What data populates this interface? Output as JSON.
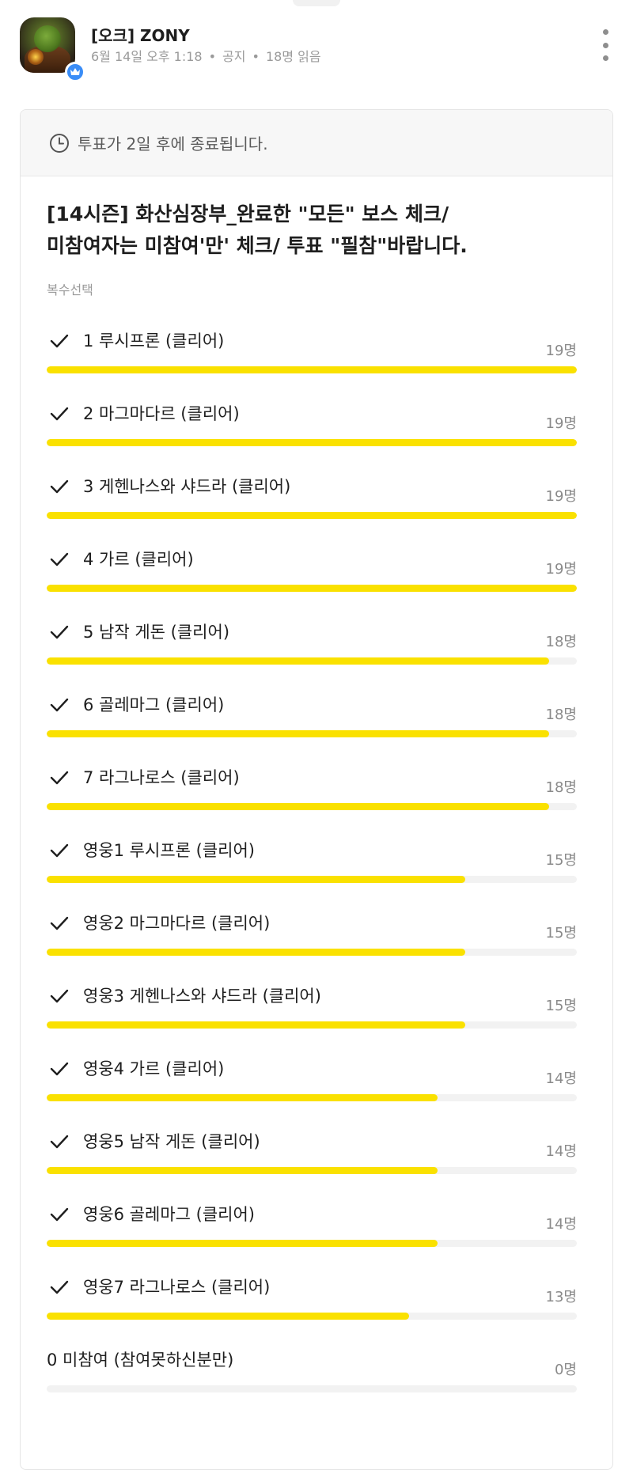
{
  "post": {
    "author": "[오크] ZONY",
    "date": "6월 14일 오후 1:18",
    "category": "공지",
    "reads": "18명 읽음",
    "badge_icon": "crown-icon",
    "more_icon": "more-vertical-icon"
  },
  "poll": {
    "notice": "투표가 2일 후에 종료됩니다.",
    "title_line1": "[14시즌] 화산심장부_완료한 \"모든\" 보스 체크/",
    "title_line2": "미참여자는 미참여'만' 체크/ 투표 \"필참\"바랍니다.",
    "mode": "복수선택",
    "total_voters": 19,
    "accent_color": "#fae100",
    "options": [
      {
        "label": "1 루시프론 (클리어)",
        "count": "19명",
        "votes": 19,
        "checked": true
      },
      {
        "label": "2 마그마다르 (클리어)",
        "count": "19명",
        "votes": 19,
        "checked": true
      },
      {
        "label": "3 게헨나스와 샤드라 (클리어)",
        "count": "19명",
        "votes": 19,
        "checked": true
      },
      {
        "label": "4 가르 (클리어)",
        "count": "19명",
        "votes": 19,
        "checked": true
      },
      {
        "label": "5 남작 게돈 (클리어)",
        "count": "18명",
        "votes": 18,
        "checked": true
      },
      {
        "label": "6 골레마그 (클리어)",
        "count": "18명",
        "votes": 18,
        "checked": true
      },
      {
        "label": "7 라그나로스 (클리어)",
        "count": "18명",
        "votes": 18,
        "checked": true
      },
      {
        "label": "영웅1 루시프론 (클리어)",
        "count": "15명",
        "votes": 15,
        "checked": true
      },
      {
        "label": "영웅2 마그마다르 (클리어)",
        "count": "15명",
        "votes": 15,
        "checked": true
      },
      {
        "label": "영웅3 게헨나스와 샤드라 (클리어)",
        "count": "15명",
        "votes": 15,
        "checked": true
      },
      {
        "label": "영웅4 가르 (클리어)",
        "count": "14명",
        "votes": 14,
        "checked": true
      },
      {
        "label": "영웅5 남작 게돈 (클리어)",
        "count": "14명",
        "votes": 14,
        "checked": true
      },
      {
        "label": "영웅6 골레마그 (클리어)",
        "count": "14명",
        "votes": 14,
        "checked": true
      },
      {
        "label": "영웅7 라그나로스 (클리어)",
        "count": "13명",
        "votes": 13,
        "checked": true
      },
      {
        "label": "0 미참여 (참여못하신분만)",
        "count": "0명",
        "votes": 0,
        "checked": false
      }
    ]
  }
}
